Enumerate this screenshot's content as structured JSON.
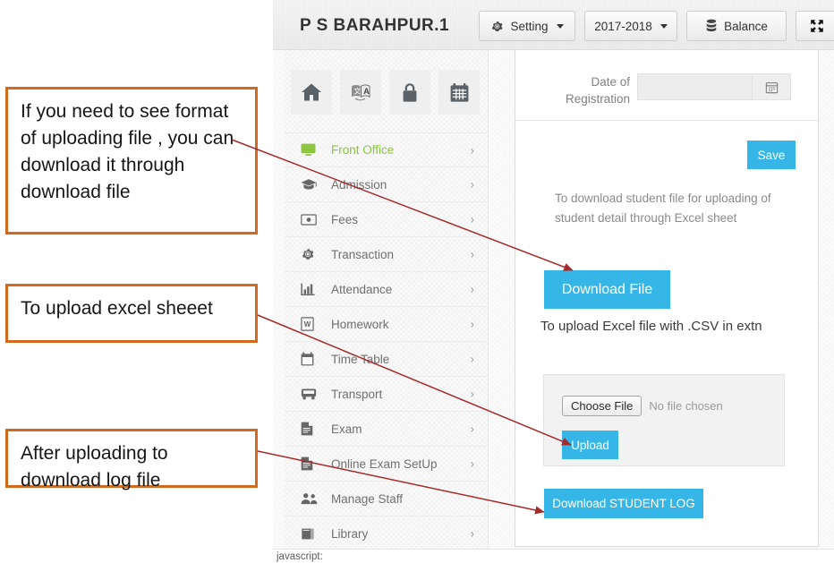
{
  "header": {
    "school_name": "P S BARAHPUR.1",
    "buttons": [
      {
        "label": "Setting",
        "icon": "gear-icon",
        "caret": true
      },
      {
        "label": "2017-2018",
        "icon": "",
        "caret": true
      },
      {
        "label": "Balance",
        "icon": "database-icon",
        "caret": false
      },
      {
        "label": "",
        "icon": "expand-icon",
        "caret": false
      }
    ]
  },
  "sidebar": {
    "icon_tiles": [
      {
        "name": "home-icon"
      },
      {
        "name": "translate-icon"
      },
      {
        "name": "lock-icon"
      },
      {
        "name": "calendar-icon"
      }
    ],
    "items": [
      {
        "label": "Front Office",
        "icon": "monitor-icon",
        "active": true,
        "arrow": "›"
      },
      {
        "label": "Admission",
        "icon": "graduation-icon",
        "active": false,
        "arrow": "›"
      },
      {
        "label": "Fees",
        "icon": "money-icon",
        "active": false,
        "arrow": "›"
      },
      {
        "label": "Transaction",
        "icon": "gear-icon",
        "active": false,
        "arrow": "›"
      },
      {
        "label": "Attendance",
        "icon": "bar-chart-icon",
        "active": false,
        "arrow": "›"
      },
      {
        "label": "Homework",
        "icon": "document-w-icon",
        "active": false,
        "arrow": "›"
      },
      {
        "label": "Time Table",
        "icon": "calendar-icon",
        "active": false,
        "arrow": "›"
      },
      {
        "label": "Transport",
        "icon": "bus-icon",
        "active": false,
        "arrow": "›"
      },
      {
        "label": "Exam",
        "icon": "file-icon",
        "active": false,
        "arrow": "›"
      },
      {
        "label": "Online Exam SetUp",
        "icon": "file-icon",
        "active": false,
        "arrow": "›"
      },
      {
        "label": "Manage Staff",
        "icon": "users-icon",
        "active": false,
        "arrow": ""
      },
      {
        "label": "Library",
        "icon": "book-icon",
        "active": false,
        "arrow": "›"
      }
    ]
  },
  "content": {
    "date_label": "Date of Registration",
    "date_value": "",
    "date_placeholder": "",
    "save_label": "Save",
    "help_text": "To download student file for uploading of student detail through Excel sheet",
    "download_file_label": "Download File",
    "upload_note": "To upload Excel file with .CSV in extn",
    "choose_file_label": "Choose File",
    "no_file_text": "No file chosen",
    "upload_label": "Upload",
    "download_log_label": "Download STUDENT LOG"
  },
  "status_bar": {
    "text": "javascript:"
  },
  "annotations": [
    {
      "text": "If you need to see format of uploading file , you can download it through download file"
    },
    {
      "text": "To upload excel sheeet"
    },
    {
      "text": "After uploading to download log file"
    }
  ],
  "colors": {
    "accent_blue": "#36b6e6",
    "active_green": "#8dc63f",
    "annotation_border": "#d2691e",
    "arrow_red": "#a52a2a"
  }
}
